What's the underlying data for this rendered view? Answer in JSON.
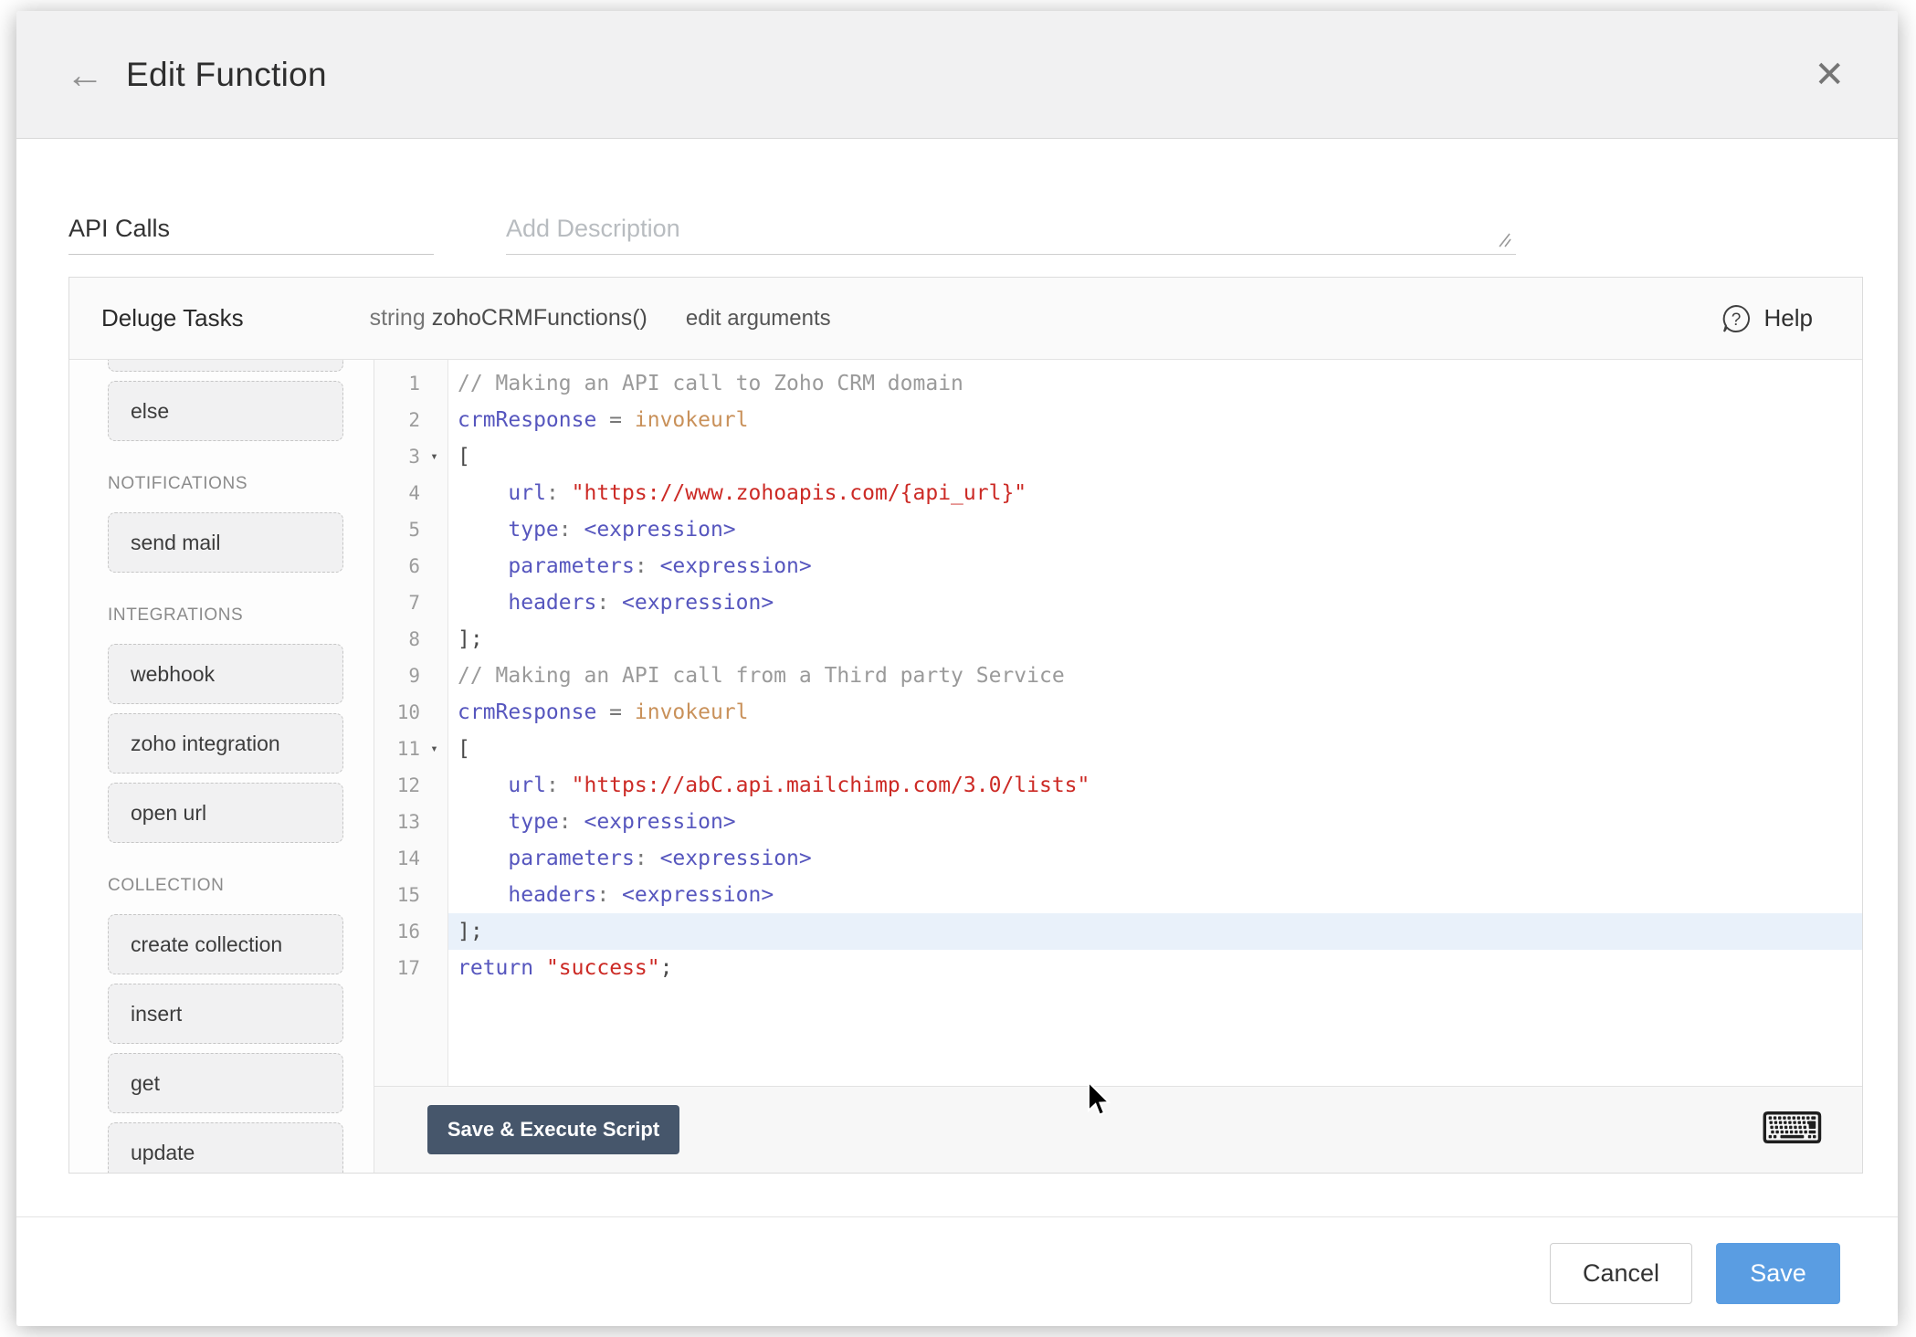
{
  "dialog": {
    "title": "Edit Function"
  },
  "icons": {
    "back_glyph": "←",
    "close_glyph": "✕",
    "fold_glyph": "▾",
    "help_glyph": "?",
    "keyboard_glyph": "⌨"
  },
  "form": {
    "function_name_value": "API Calls",
    "description_placeholder": "Add Description"
  },
  "panel": {
    "title": "Deluge Tasks",
    "signature": {
      "return_type": "string",
      "name": "zohoCRMFunctions()"
    },
    "edit_arguments_label": "edit arguments",
    "help_label": "Help",
    "sidebar": [
      {
        "type": "partial",
        "label": ""
      },
      {
        "type": "task",
        "label": "else"
      },
      {
        "type": "section",
        "label": "NOTIFICATIONS"
      },
      {
        "type": "task",
        "label": "send mail"
      },
      {
        "type": "section",
        "label": "INTEGRATIONS"
      },
      {
        "type": "task",
        "label": "webhook"
      },
      {
        "type": "task",
        "label": "zoho integration"
      },
      {
        "type": "task",
        "label": "open url"
      },
      {
        "type": "section",
        "label": "COLLECTION"
      },
      {
        "type": "task",
        "label": "create collection"
      },
      {
        "type": "task",
        "label": "insert"
      },
      {
        "type": "task",
        "label": "get"
      },
      {
        "type": "task",
        "label": "update"
      }
    ]
  },
  "editor": {
    "lines": [
      {
        "n": 1,
        "fold": false,
        "active": false,
        "segments": [
          [
            "comment",
            "// Making an API call to Zoho CRM domain"
          ]
        ]
      },
      {
        "n": 2,
        "fold": false,
        "active": false,
        "segments": [
          [
            "ident",
            "crmResponse"
          ],
          [
            "op",
            " = "
          ],
          [
            "builtin",
            "invokeurl"
          ]
        ]
      },
      {
        "n": 3,
        "fold": true,
        "active": false,
        "segments": [
          [
            "plain",
            "["
          ]
        ]
      },
      {
        "n": 4,
        "fold": false,
        "active": false,
        "segments": [
          [
            "plain",
            "    "
          ],
          [
            "ident",
            "url"
          ],
          [
            "op",
            ": "
          ],
          [
            "string",
            "\"https://www.zohoapis.com/{api_url}\""
          ]
        ]
      },
      {
        "n": 5,
        "fold": false,
        "active": false,
        "segments": [
          [
            "plain",
            "    "
          ],
          [
            "ident",
            "type"
          ],
          [
            "op",
            ": "
          ],
          [
            "ident",
            "<expression>"
          ]
        ]
      },
      {
        "n": 6,
        "fold": false,
        "active": false,
        "segments": [
          [
            "plain",
            "    "
          ],
          [
            "ident",
            "parameters"
          ],
          [
            "op",
            ": "
          ],
          [
            "ident",
            "<expression>"
          ]
        ]
      },
      {
        "n": 7,
        "fold": false,
        "active": false,
        "segments": [
          [
            "plain",
            "    "
          ],
          [
            "ident",
            "headers"
          ],
          [
            "op",
            ": "
          ],
          [
            "ident",
            "<expression>"
          ]
        ]
      },
      {
        "n": 8,
        "fold": false,
        "active": false,
        "segments": [
          [
            "plain",
            "];"
          ]
        ]
      },
      {
        "n": 9,
        "fold": false,
        "active": false,
        "segments": [
          [
            "comment",
            "// Making an API call from a Third party Service"
          ]
        ]
      },
      {
        "n": 10,
        "fold": false,
        "active": false,
        "segments": [
          [
            "ident",
            "crmResponse"
          ],
          [
            "op",
            " = "
          ],
          [
            "builtin",
            "invokeurl"
          ]
        ]
      },
      {
        "n": 11,
        "fold": true,
        "active": false,
        "segments": [
          [
            "plain",
            "["
          ]
        ]
      },
      {
        "n": 12,
        "fold": false,
        "active": false,
        "segments": [
          [
            "plain",
            "    "
          ],
          [
            "ident",
            "url"
          ],
          [
            "op",
            ": "
          ],
          [
            "string",
            "\"https://abC.api.mailchimp.com/3.0/lists\""
          ]
        ]
      },
      {
        "n": 13,
        "fold": false,
        "active": false,
        "segments": [
          [
            "plain",
            "    "
          ],
          [
            "ident",
            "type"
          ],
          [
            "op",
            ": "
          ],
          [
            "ident",
            "<expression>"
          ]
        ]
      },
      {
        "n": 14,
        "fold": false,
        "active": false,
        "segments": [
          [
            "plain",
            "    "
          ],
          [
            "ident",
            "parameters"
          ],
          [
            "op",
            ": "
          ],
          [
            "ident",
            "<expression>"
          ]
        ]
      },
      {
        "n": 15,
        "fold": false,
        "active": false,
        "segments": [
          [
            "plain",
            "    "
          ],
          [
            "ident",
            "headers"
          ],
          [
            "op",
            ": "
          ],
          [
            "ident",
            "<expression>"
          ]
        ]
      },
      {
        "n": 16,
        "fold": false,
        "active": true,
        "segments": [
          [
            "plain",
            "];"
          ]
        ]
      },
      {
        "n": 17,
        "fold": false,
        "active": false,
        "segments": [
          [
            "ident",
            "return"
          ],
          [
            "plain",
            " "
          ],
          [
            "string",
            "\"success\""
          ],
          [
            "plain",
            ";"
          ]
        ]
      }
    ],
    "run_button_label": "Save & Execute Script"
  },
  "footer": {
    "cancel_label": "Cancel",
    "save_label": "Save"
  },
  "colors": {
    "accent_save": "#5A9DE2",
    "run_button_bg": "#46566B",
    "active_line_bg": "#E9F1FA",
    "token_comment": "#9A9A9A",
    "token_identifier": "#5656BE",
    "token_builtin": "#C9915A",
    "token_string": "#CC2A25",
    "token_operator": "#777777",
    "token_plain": "#4A4A4A"
  }
}
